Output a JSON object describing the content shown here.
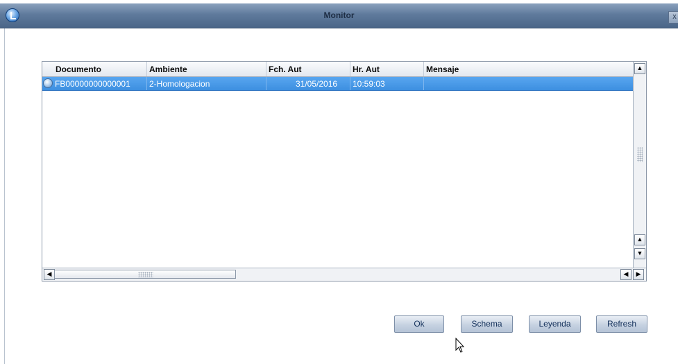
{
  "window": {
    "title": "Monitor",
    "close_glyph": "x"
  },
  "grid": {
    "columns": [
      "Documento",
      "Ambiente",
      "Fch. Aut",
      "Hr. Aut",
      "Mensaje"
    ],
    "rows": [
      {
        "documento": "FB00000000000001",
        "ambiente": "2-Homologacion",
        "fch_aut": "31/05/2016",
        "hr_aut": "10:59:03",
        "mensaje": "",
        "selected": true
      }
    ]
  },
  "buttons": {
    "ok": "Ok",
    "schema": "Schema",
    "leyenda": "Leyenda",
    "refresh": "Refresh"
  },
  "colors": {
    "titlebar": "#5f7a9c",
    "selected_row": "#4a98e8",
    "button_text": "#15325c"
  }
}
